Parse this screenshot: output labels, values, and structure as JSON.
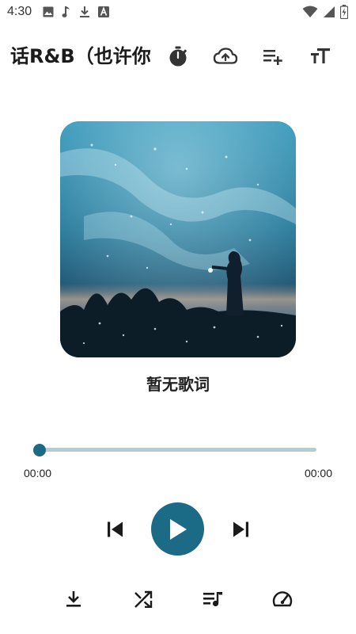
{
  "status_bar": {
    "time": "4:30",
    "left_icons": [
      "image-icon",
      "music-note-icon",
      "download-icon",
      "a-font-icon"
    ],
    "right_icons": [
      "wifi-icon",
      "signal-icon",
      "battery-icon"
    ]
  },
  "header": {
    "title": "话R&B（也许你",
    "actions": [
      "timer-icon",
      "cloud-upload-icon",
      "playlist-add-icon",
      "text-size-icon"
    ]
  },
  "lyrics": "暂无歌词",
  "player": {
    "current_time": "00:00",
    "total_time": "00:00",
    "progress": 0,
    "controls": [
      "skip-previous-icon",
      "play-icon",
      "skip-next-icon"
    ]
  },
  "bottom_actions": [
    "download-icon",
    "shuffle-icon",
    "queue-music-icon",
    "speed-icon"
  ],
  "colors": {
    "accent": "#1b6a86",
    "track": "#b2cdd7",
    "text": "#1b1b1b"
  }
}
